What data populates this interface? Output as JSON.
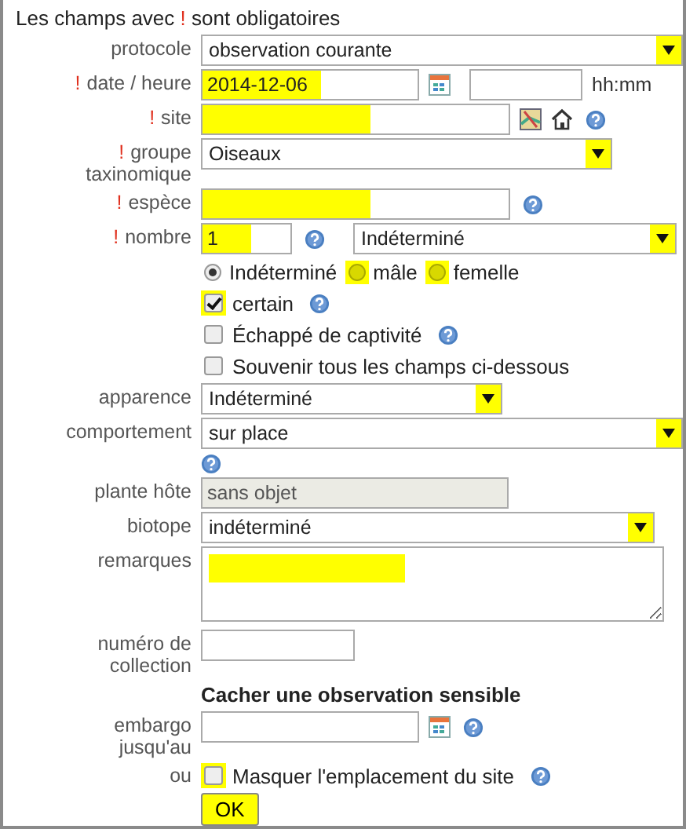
{
  "notice": {
    "before": "Les champs avec",
    "mark": "!",
    "after": "sont obligatoires"
  },
  "rows": [
    {
      "kind": "select",
      "label": "protocole",
      "value": "observation courante",
      "highlighted": true,
      "help": false
    },
    {
      "kind": "datetime",
      "label": "date / heure",
      "mark": "!",
      "value": "2014-12-06",
      "highlighted": true,
      "suffix": "hh:mm"
    },
    {
      "kind": "text",
      "label": "site",
      "mark": "!",
      "highlighted": true,
      "map_tools": true,
      "help": true,
      "disabled": false
    },
    {
      "kind": "select",
      "label": "groupe taxinomique",
      "mark": "!",
      "value": "Oiseaux",
      "highlighted": true,
      "help": false
    },
    {
      "kind": "text",
      "label": "espèce",
      "mark": "!",
      "highlighted": true,
      "map_tools": false,
      "help": true,
      "disabled": false
    },
    {
      "kind": "count",
      "label": "nombre",
      "mark": "!",
      "value": "1",
      "highlighted": true,
      "help": true,
      "select": {
        "value": "Indéterminé",
        "highlighted": true
      }
    },
    {
      "kind": "radios",
      "options": [
        {
          "label": "Indéterminé",
          "selected": true,
          "highlighted": false
        },
        {
          "label": "mâle",
          "selected": false,
          "highlighted": true
        },
        {
          "label": "femelle",
          "selected": false,
          "highlighted": true
        }
      ]
    },
    {
      "kind": "checkbox",
      "text": "certain",
      "checked": true,
      "highlighted": true,
      "help": true
    },
    {
      "kind": "checkbox",
      "text": "Échappé de captivité",
      "checked": false,
      "highlighted": false,
      "help": true
    },
    {
      "kind": "checkbox",
      "text": "Souvenir tous les champs ci-dessous",
      "checked": false,
      "highlighted": false,
      "help": false
    },
    {
      "kind": "select",
      "label": "apparence",
      "value": "Indéterminé",
      "highlighted": true,
      "help": false
    },
    {
      "kind": "select",
      "label": "comportement",
      "value": "sur place",
      "highlighted": true,
      "help": true
    },
    {
      "kind": "text",
      "label": "plante hôte",
      "value": "sans objet",
      "highlighted": false,
      "map_tools": false,
      "help": false,
      "disabled": true
    },
    {
      "kind": "select",
      "label": "biotope",
      "value": "indéterminé",
      "highlighted": true,
      "help": false
    },
    {
      "kind": "textarea",
      "label": "remarques",
      "highlighted": true
    },
    {
      "kind": "text",
      "label": "numéro de collection",
      "highlighted": false,
      "map_tools": false,
      "help": false,
      "disabled": false
    },
    {
      "kind": "heading",
      "text": "Cacher une observation sensible"
    },
    {
      "kind": "date",
      "label": "embargo jusqu'au",
      "help": true
    },
    {
      "kind": "checkbox",
      "label": "ou",
      "text": "Masquer l'emplacement du site",
      "checked": false,
      "highlighted": true,
      "help": true
    },
    {
      "kind": "button",
      "text": "OK",
      "highlighted": true
    }
  ]
}
